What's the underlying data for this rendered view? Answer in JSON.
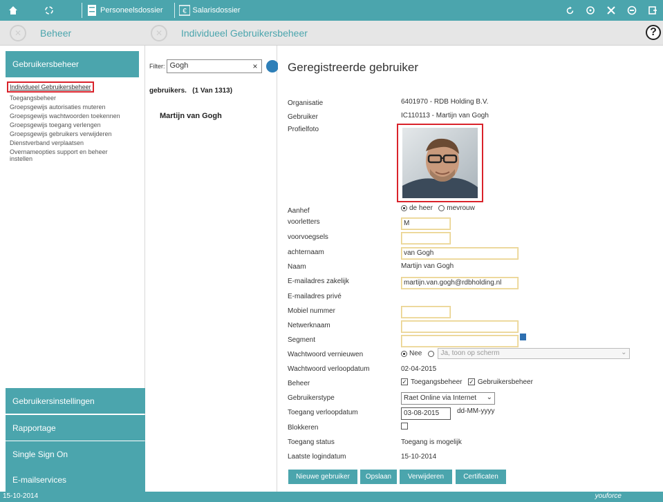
{
  "topbar": {
    "home_icon": "home-icon",
    "loading_icon": "spinner-icon",
    "links": [
      {
        "label": "Personeelsdossier",
        "icon": "file-cabinet-icon"
      },
      {
        "label": "Salarisdossier",
        "icon": "money-icon"
      }
    ],
    "right_icons": [
      "refresh-icon",
      "settings-icon",
      "tools-icon",
      "user-icon",
      "logout-icon"
    ]
  },
  "breadcrumb": {
    "section": "Beheer",
    "page": "Individueel Gebruikersbeheer"
  },
  "left_nav": {
    "header": "Gebruikersbeheer",
    "items": [
      "Individueel Gebruikersbeheer",
      "Toegangsbeheer",
      "Groepsgewijs autorisaties muteren",
      "Groepsgewijs wachtwoorden toekennen",
      "Groepsgewijs toegang verlengen",
      "Groepsgewijs gebruikers verwijderen",
      "Dienstverband verplaatsen",
      "Overnameopties support en beheer instellen"
    ],
    "bottom_sections": [
      "Gebruikersinstellingen",
      "Rapportage",
      "Single Sign On",
      "E-mailservices"
    ]
  },
  "filter": {
    "label": "Filter:",
    "value": "Gogh",
    "clear": "×",
    "count_label": "gebruikers.",
    "count_text": "(1 Van 1313)",
    "results": [
      "Martijn van Gogh"
    ]
  },
  "detail": {
    "title": "Geregistreerde gebruiker",
    "organisatie_label": "Organisatie",
    "organisatie_value": "6401970 - RDB Holding B.V.",
    "gebruiker_label": "Gebruiker",
    "gebruiker_value": "IC110113 - Martijn van Gogh",
    "profielfoto_label": "Profielfoto",
    "aanhef_label": "Aanhef",
    "aanhef_options": [
      "de heer",
      "mevrouw"
    ],
    "aanhef_selected": "de heer",
    "voorletters_label": "voorletters",
    "voorletters_value": "M",
    "voorvoegsels_label": "voorvoegsels",
    "voorvoegsels_value": "",
    "achternaam_label": "achternaam",
    "achternaam_value": "van Gogh",
    "naam_label": "Naam",
    "naam_value": "Martijn van Gogh",
    "email_zakelijk_label": "E-mailadres zakelijk",
    "email_zakelijk_value": "martijn.van.gogh@rdbholding.nl",
    "email_prive_label": "E-mailadres privé",
    "mobiel_label": "Mobiel nummer",
    "mobiel_value": "",
    "netwerknaam_label": "Netwerknaam",
    "netwerknaam_value": "",
    "segment_label": "Segment",
    "segment_value": "",
    "ww_vernieuwen_label": "Wachtwoord vernieuwen",
    "ww_vernieuwen_options": [
      "Nee",
      "Ja, toon op scherm"
    ],
    "ww_vernieuwen_selected": "Nee",
    "ww_verloop_label": "Wachtwoord verloopdatum",
    "ww_verloop_value": "02-04-2015",
    "beheer_label": "Beheer",
    "beheer_options": [
      "Toegangsbeheer",
      "Gebruikersbeheer"
    ],
    "gebruikerstype_label": "Gebruikerstype",
    "gebruikerstype_value": "Raet Online via Internet",
    "toegang_verloop_label": "Toegang verloopdatum",
    "toegang_verloop_value": "03-08-2015",
    "toegang_verloop_format": "dd-MM-yyyy",
    "blokkeren_label": "Blokkeren",
    "toegang_status_label": "Toegang status",
    "toegang_status_value": "Toegang is mogelijk",
    "laatste_login_label": "Laatste logindatum",
    "laatste_login_value": "15-10-2014"
  },
  "actions": {
    "new": "Nieuwe gebruiker",
    "save": "Opslaan",
    "delete": "Verwijderen",
    "certs": "Certificaten"
  },
  "statusbar": {
    "date": "15-10-2014",
    "brand": "youforce"
  }
}
